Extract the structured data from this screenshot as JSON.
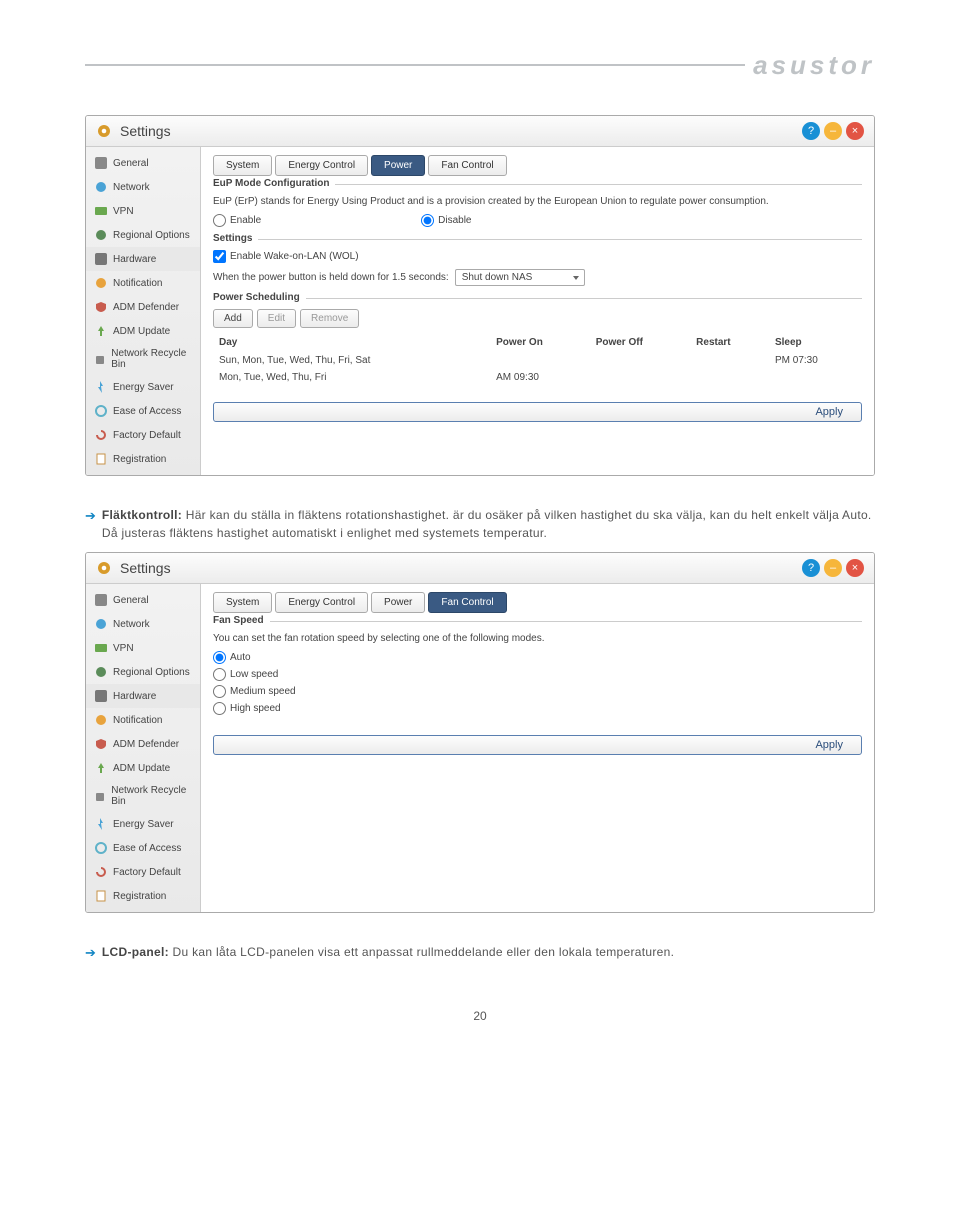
{
  "logo": "asustor",
  "page_number": "20",
  "text1_lead": "Fläktkontroll:",
  "text1_body": " Här kan du ställa in fläktens rotationshastighet. är du osäker på vilken hastighet du ska välja, kan du helt enkelt välja Auto. Då justeras fläktens hastighet automatiskt i enlighet med systemets temperatur.",
  "text2_lead": "LCD-panel:",
  "text2_body": " Du kan låta LCD-panelen visa ett anpassat rullmeddelande eller den lokala temperaturen.",
  "win": {
    "title": "Settings"
  },
  "ctrls": {
    "help": "?",
    "min": "–",
    "close": "×"
  },
  "sidebar": {
    "items": [
      {
        "label": "General"
      },
      {
        "label": "Network"
      },
      {
        "label": "VPN"
      },
      {
        "label": "Regional Options"
      },
      {
        "label": "Hardware"
      },
      {
        "label": "Notification"
      },
      {
        "label": "ADM Defender"
      },
      {
        "label": "ADM Update"
      },
      {
        "label": "Network Recycle Bin"
      },
      {
        "label": "Energy Saver"
      },
      {
        "label": "Ease of Access"
      },
      {
        "label": "Factory Default"
      },
      {
        "label": "Registration"
      }
    ]
  },
  "tabs": {
    "system": "System",
    "energy": "Energy Control",
    "power": "Power",
    "fan": "Fan Control"
  },
  "win1": {
    "eup_title": "EuP Mode Configuration",
    "eup_desc": "EuP (ErP) stands for Energy Using Product and is a provision created by the European Union to regulate power consumption.",
    "enable": "Enable",
    "disable": "Disable",
    "settings_title": "Settings",
    "wol": "Enable Wake-on-LAN (WOL)",
    "held_text": "When the power button is held down for 1.5 seconds:",
    "held_value": "Shut down NAS",
    "sched_title": "Power Scheduling",
    "add": "Add",
    "edit": "Edit",
    "remove": "Remove",
    "cols": {
      "day": "Day",
      "on": "Power On",
      "off": "Power Off",
      "restart": "Restart",
      "sleep": "Sleep"
    },
    "rows": [
      {
        "day": "Sun, Mon, Tue, Wed, Thu, Fri, Sat",
        "on": "",
        "off": "",
        "restart": "",
        "sleep": "PM 07:30"
      },
      {
        "day": "Mon, Tue, Wed, Thu, Fri",
        "on": "AM 09:30",
        "off": "",
        "restart": "",
        "sleep": ""
      }
    ],
    "apply": "Apply"
  },
  "win2": {
    "fan_title": "Fan Speed",
    "fan_desc": "You can set the fan rotation speed by selecting one of the following modes.",
    "auto": "Auto",
    "low": "Low speed",
    "med": "Medium speed",
    "high": "High speed",
    "apply": "Apply"
  }
}
